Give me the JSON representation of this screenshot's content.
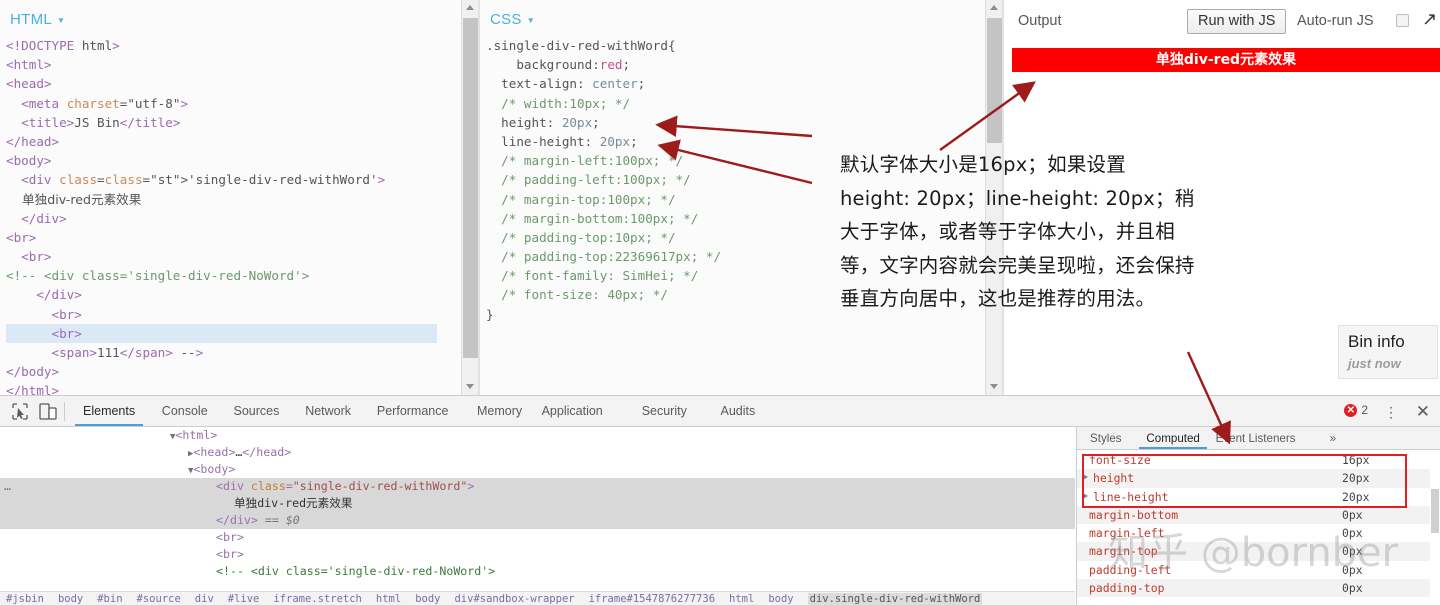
{
  "editors": {
    "html": {
      "label": "HTML",
      "caret": "chevron-down-icon",
      "lines": [
        "<!DOCTYPE html>",
        "<html>",
        "<head>",
        "  <meta charset=\"utf-8\">",
        "  <title>JS Bin</title>",
        "</head>",
        "<body>",
        "  <div class='single-div-red-withWord'>",
        "    单独div-red元素效果",
        "  </div>",
        "<br>",
        "  <br>",
        "<!-- <div class='single-div-red-NoWord'>",
        "    </div>",
        "      <br>",
        "      <br>",
        "      <span>111</span> -->",
        "</body>",
        "</html>"
      ],
      "highlighted_line_index": 15
    },
    "css": {
      "label": "CSS",
      "caret": "chevron-down-icon",
      "lines": [
        ".single-div-red-withWord{",
        "    background:red;",
        "  text-align: center;",
        "  /* width:10px; */",
        "  height: 20px;",
        "  line-height: 20px;",
        "  /* margin-left:100px; */",
        "  /* padding-left:100px; */",
        "  /* margin-top:100px; */",
        "  /* margin-bottom:100px; */",
        "  /* padding-top:10px; */",
        "  /* padding-top:22369617px; */",
        "  /* font-family: SimHei; */",
        "  /* font-size: 40px; */",
        "}"
      ]
    }
  },
  "output": {
    "title": "Output",
    "run_button": "Run with JS",
    "autorun_label": "Auto-run JS",
    "autorun_checked": false,
    "expand_icon": "expand-arrow-icon",
    "rendered_text": "单独div-red元素效果",
    "rendered_bg_color": "#ff0000",
    "rendered_text_color": "#ffffff"
  },
  "bin_info": {
    "title": "Bin info",
    "subtitle": "just now"
  },
  "annotation": {
    "text": "默认字体大小是16px；如果设置height: 20px；line-height: 20px；稍大于字体，或者等于字体大小，并且相等，文字内容就会完美呈现啦，还会保持垂直方向居中，这也是推荐的用法。",
    "arrow_color": "#9e1b1b"
  },
  "watermark": "知乎 @bornber",
  "devtools": {
    "icons": [
      "inspect-element-icon",
      "device-toolbar-icon"
    ],
    "tabs": [
      {
        "label": "Elements",
        "active": true
      },
      {
        "label": "Console",
        "active": false
      },
      {
        "label": "Sources",
        "active": false
      },
      {
        "label": "Network",
        "active": false
      },
      {
        "label": "Performance",
        "active": false
      },
      {
        "label": "Memory",
        "active": false
      },
      {
        "label": "Application",
        "active": false
      },
      {
        "label": "Security",
        "active": false
      },
      {
        "label": "Audits",
        "active": false
      }
    ],
    "error_count": "2",
    "error_icon": "error-circle-icon",
    "menu_icon": "kebab-menu-icon",
    "close_icon": "close-icon",
    "dom_tree": [
      {
        "indent": 0,
        "twisty": "down",
        "html": "<span class=\"dtag\">&lt;html&gt;</span>",
        "selected": false
      },
      {
        "indent": 1,
        "twisty": "right",
        "html": "<span class=\"dtag\">&lt;head&gt;</span><span class=\"dtxt\">…</span><span class=\"dtag\">&lt;/head&gt;</span>",
        "selected": false
      },
      {
        "indent": 1,
        "twisty": "down",
        "html": "<span class=\"dtag\">&lt;body&gt;</span>",
        "selected": false
      },
      {
        "indent": 2,
        "twisty": "",
        "html": "<span class=\"dtag\">&lt;div </span><span class=\"dattr\">class</span><span class=\"dtag\">=</span><span class=\"dval\">\"single-div-red-withWord\"</span><span class=\"dtag\">&gt;</span>",
        "selected": true
      },
      {
        "indent": 3,
        "twisty": "",
        "html": "<span class=\"dtxt\">单独div-red元素效果</span>",
        "selected": true
      },
      {
        "indent": 2,
        "twisty": "",
        "html": "<span class=\"dtag\">&lt;/div&gt;</span> <span class=\"ddollar\">== $0</span>",
        "selected": true
      },
      {
        "indent": 2,
        "twisty": "",
        "html": "<span class=\"dtag\">&lt;br&gt;</span>",
        "selected": false
      },
      {
        "indent": 2,
        "twisty": "",
        "html": "<span class=\"dtag\">&lt;br&gt;</span>",
        "selected": false
      },
      {
        "indent": 2,
        "twisty": "",
        "html": "<span class=\"dcom\">&lt;!-- &lt;div class='single-div-red-NoWord'&gt;</span>",
        "selected": false
      }
    ],
    "breadcrumbs": [
      "#jsbin",
      "body",
      "#bin",
      "#source",
      "div",
      "#live",
      "iframe.stretch",
      "html",
      "body",
      "div#sandbox-wrapper",
      "iframe#1547876277736",
      "html",
      "body",
      "div.single-div-red-withWord"
    ],
    "sidebar_tabs": [
      {
        "label": "Styles",
        "active": false
      },
      {
        "label": "Computed",
        "active": true
      },
      {
        "label": "Event Listeners",
        "active": false
      },
      {
        "label": "»",
        "active": false
      }
    ],
    "computed": [
      {
        "name": "font-size",
        "value": "16px",
        "expandable": false,
        "highlighted": true
      },
      {
        "name": "height",
        "value": "20px",
        "expandable": true,
        "highlighted": true
      },
      {
        "name": "line-height",
        "value": "20px",
        "expandable": true,
        "highlighted": true
      },
      {
        "name": "margin-bottom",
        "value": "0px",
        "expandable": false,
        "highlighted": false
      },
      {
        "name": "margin-left",
        "value": "0px",
        "expandable": false,
        "highlighted": false
      },
      {
        "name": "margin-top",
        "value": "0px",
        "expandable": false,
        "highlighted": false
      },
      {
        "name": "padding-left",
        "value": "0px",
        "expandable": false,
        "highlighted": false
      },
      {
        "name": "padding-top",
        "value": "0px",
        "expandable": false,
        "highlighted": false
      }
    ]
  }
}
